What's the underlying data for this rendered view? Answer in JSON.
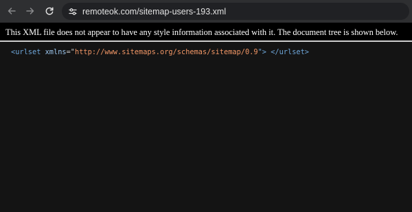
{
  "browser": {
    "url": "remoteok.com/sitemap-users-193.xml",
    "icons": {
      "back": "arrow-left-icon",
      "forward": "arrow-right-icon",
      "reload": "reload-icon",
      "site_info": "tune-icon"
    }
  },
  "xml_viewer": {
    "info_message": "This XML file does not appear to have any style information associated with it. The document tree is shown below.",
    "tree": {
      "open_tag": "<urlset",
      "attr_name": "xmlns",
      "equals_quote": "=\"",
      "attr_value": "http://www.sitemaps.org/schemas/sitemap/0.9",
      "close_quote_bracket": "\">",
      "close_tag": "</urlset>"
    }
  },
  "colors": {
    "toolbar_bg": "#2e2f31",
    "omnibox_bg": "#202124",
    "page_bg": "#141414",
    "tag": "#6ea6d9",
    "attr_name": "#9cc6ee",
    "attr_value": "#f29766"
  }
}
